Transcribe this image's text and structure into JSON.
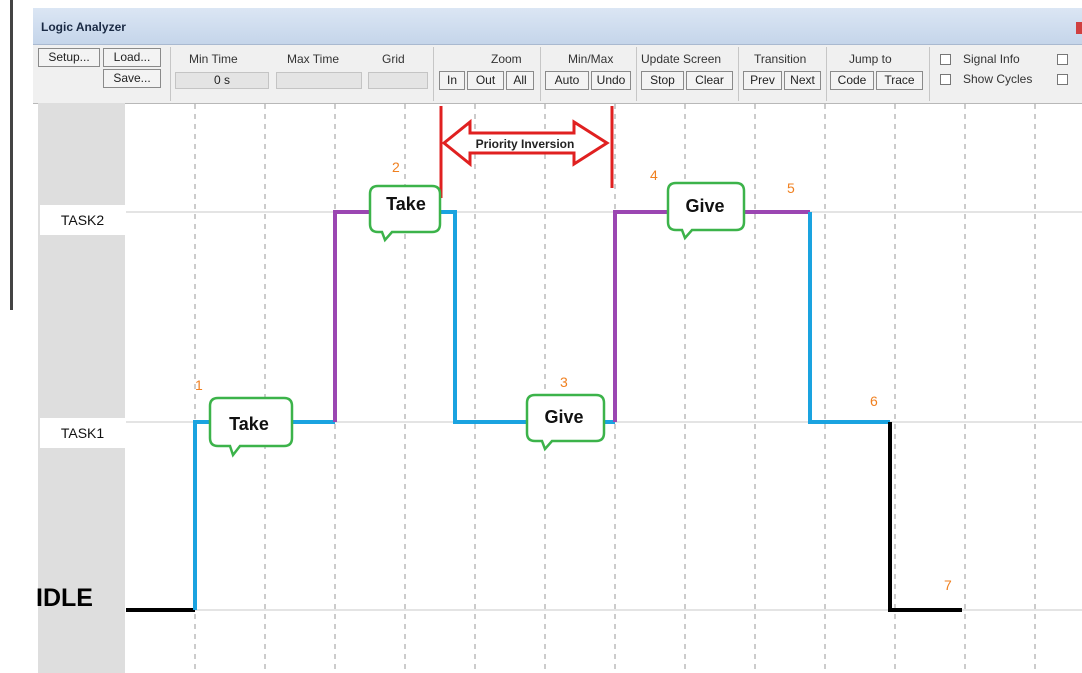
{
  "window": {
    "title": "Logic Analyzer"
  },
  "toolbar": {
    "setup": "Setup...",
    "load": "Load...",
    "save": "Save...",
    "min_time_label": "Min Time",
    "min_time_value": "0 s",
    "max_time_label": "Max Time",
    "grid_label": "Grid",
    "zoom_label": "Zoom",
    "zoom_in": "In",
    "zoom_out": "Out",
    "zoom_all": "All",
    "minmax_label": "Min/Max",
    "auto": "Auto",
    "undo": "Undo",
    "update_label": "Update Screen",
    "stop": "Stop",
    "clear": "Clear",
    "transition_label": "Transition",
    "prev": "Prev",
    "next": "Next",
    "jump_label": "Jump to",
    "code": "Code",
    "trace": "Trace",
    "signal_info": "Signal Info",
    "show_cycles": "Show Cycles"
  },
  "signals": {
    "task2": "TASK2",
    "task1": "TASK1",
    "idle": "IDLE"
  },
  "annotations": {
    "priority_inversion": "Priority Inversion",
    "bubbles": [
      "Take",
      "Take",
      "Give",
      "Give"
    ],
    "markers": [
      "1",
      "2",
      "3",
      "4",
      "5",
      "6",
      "7"
    ]
  },
  "colors": {
    "task1_trace": "#1aa3e0",
    "task2_trace": "#9b46b2",
    "idle_trace": "#000000",
    "bubble_border": "#3cb34a",
    "arrow": "#e02020",
    "marker": "#f08020"
  }
}
